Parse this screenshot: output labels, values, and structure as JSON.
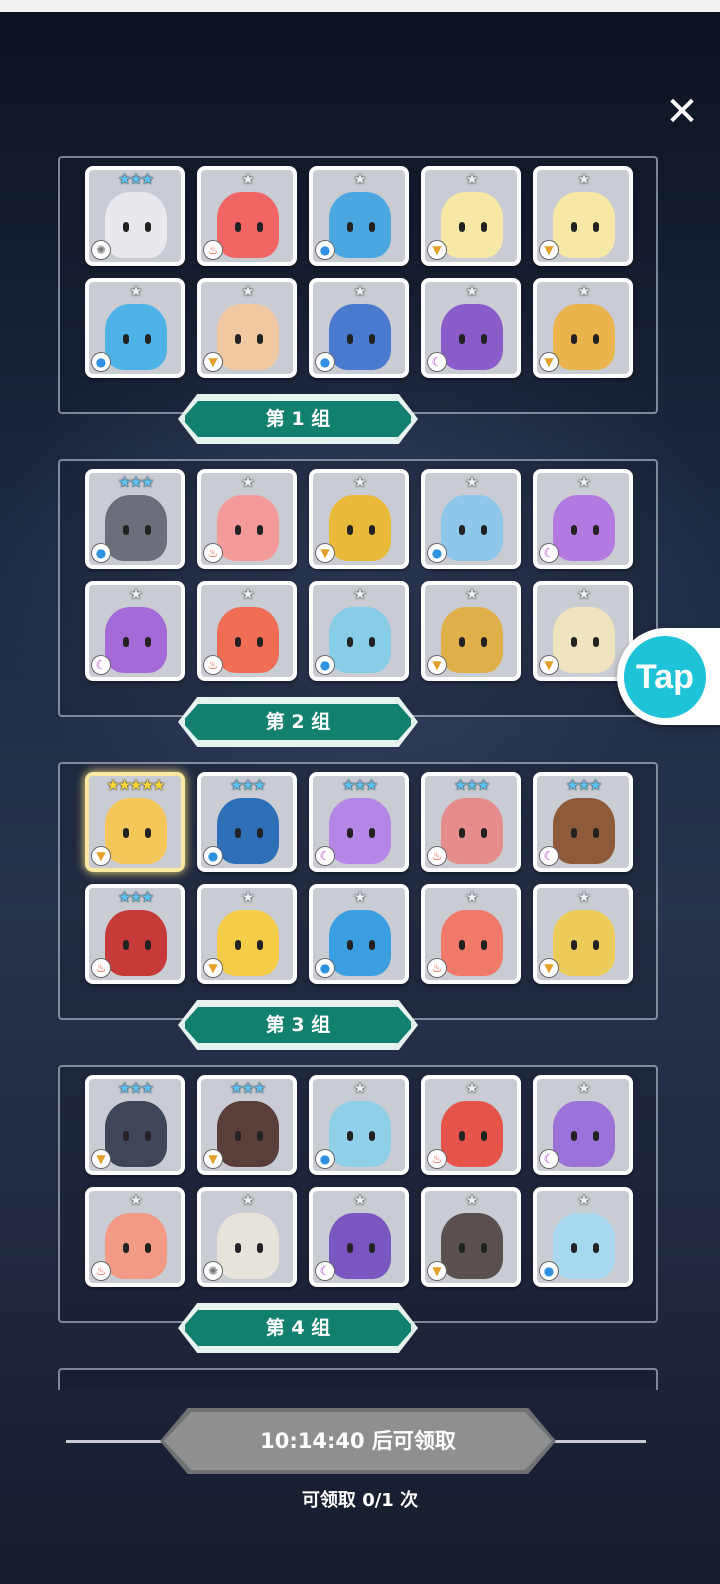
{
  "close_icon": "close-icon",
  "groups": [
    {
      "label": "第 1 组",
      "cards": [
        {
          "stars": "★★★",
          "tier": "three",
          "element": "light",
          "color": "#e8e8ee"
        },
        {
          "stars": "★",
          "tier": "one",
          "element": "fire",
          "color": "#f26565"
        },
        {
          "stars": "★",
          "tier": "one",
          "element": "water",
          "color": "#4aa7e0"
        },
        {
          "stars": "★",
          "tier": "one",
          "element": "wind",
          "color": "#f7e8a8"
        },
        {
          "stars": "★",
          "tier": "one",
          "element": "wind",
          "color": "#f7e8a8"
        },
        {
          "stars": "★",
          "tier": "one",
          "element": "water",
          "color": "#4fb2e6"
        },
        {
          "stars": "★",
          "tier": "one",
          "element": "wind",
          "color": "#f0c8a2"
        },
        {
          "stars": "★",
          "tier": "one",
          "element": "water",
          "color": "#4a7ad0"
        },
        {
          "stars": "★",
          "tier": "one",
          "element": "dark",
          "color": "#8a5cc9"
        },
        {
          "stars": "★",
          "tier": "one",
          "element": "wind",
          "color": "#e9b44c"
        }
      ]
    },
    {
      "label": "第 2 组",
      "cards": [
        {
          "stars": "★★★",
          "tier": "three",
          "element": "water",
          "color": "#6a6f7a"
        },
        {
          "stars": "★",
          "tier": "one",
          "element": "fire",
          "color": "#f49a9a"
        },
        {
          "stars": "★",
          "tier": "one",
          "element": "wind",
          "color": "#e8b93a"
        },
        {
          "stars": "★",
          "tier": "one",
          "element": "water",
          "color": "#8ec7ea"
        },
        {
          "stars": "★",
          "tier": "one",
          "element": "dark",
          "color": "#b27ae0"
        },
        {
          "stars": "★",
          "tier": "one",
          "element": "dark",
          "color": "#a46ad8"
        },
        {
          "stars": "★",
          "tier": "one",
          "element": "fire",
          "color": "#ef6c55"
        },
        {
          "stars": "★",
          "tier": "one",
          "element": "water",
          "color": "#87cde8"
        },
        {
          "stars": "★",
          "tier": "one",
          "element": "wind",
          "color": "#dfb04a"
        },
        {
          "stars": "★",
          "tier": "one",
          "element": "wind",
          "color": "#f0e3c0"
        }
      ]
    },
    {
      "label": "第 3 组",
      "cards": [
        {
          "stars": "★★★★★",
          "tier": "five",
          "element": "wind",
          "color": "#f5c65a",
          "gold": true
        },
        {
          "stars": "★★★",
          "tier": "three",
          "element": "water",
          "color": "#2f6fb8"
        },
        {
          "stars": "★★★",
          "tier": "three",
          "element": "dark",
          "color": "#b487e6"
        },
        {
          "stars": "★★★",
          "tier": "three",
          "element": "fire",
          "color": "#e58c8c"
        },
        {
          "stars": "★★★",
          "tier": "three",
          "element": "dark",
          "color": "#8e5a3a"
        },
        {
          "stars": "★★★",
          "tier": "three",
          "element": "fire",
          "color": "#c63a3a"
        },
        {
          "stars": "★",
          "tier": "one",
          "element": "wind",
          "color": "#f5cd48"
        },
        {
          "stars": "★",
          "tier": "one",
          "element": "water",
          "color": "#3a9ee0"
        },
        {
          "stars": "★",
          "tier": "one",
          "element": "fire",
          "color": "#f07a6a"
        },
        {
          "stars": "★",
          "tier": "one",
          "element": "wind",
          "color": "#eccb5a"
        }
      ]
    },
    {
      "label": "第 4 组",
      "cards": [
        {
          "stars": "★★★",
          "tier": "three",
          "element": "wind",
          "color": "#3f4658"
        },
        {
          "stars": "★★★",
          "tier": "three",
          "element": "wind",
          "color": "#5a3e3a"
        },
        {
          "stars": "★",
          "tier": "one",
          "element": "water",
          "color": "#8fd0e8"
        },
        {
          "stars": "★",
          "tier": "one",
          "element": "fire",
          "color": "#e5544a"
        },
        {
          "stars": "★",
          "tier": "one",
          "element": "dark",
          "color": "#9a72d8"
        },
        {
          "stars": "★",
          "tier": "one",
          "element": "fire",
          "color": "#f29a86"
        },
        {
          "stars": "★",
          "tier": "one",
          "element": "light",
          "color": "#e6e3da"
        },
        {
          "stars": "★",
          "tier": "one",
          "element": "dark",
          "color": "#7a56c0"
        },
        {
          "stars": "★",
          "tier": "one",
          "element": "wind",
          "color": "#5a5050"
        },
        {
          "stars": "★",
          "tier": "one",
          "element": "water",
          "color": "#a8d8ef"
        }
      ]
    }
  ],
  "element_icons": {
    "fire": {
      "glyph": "♨",
      "color": "#e2452c"
    },
    "water": {
      "glyph": "●",
      "color": "#2f8fe0"
    },
    "wind": {
      "glyph": "▼",
      "color": "#e3a02a"
    },
    "dark": {
      "glyph": "☾",
      "color": "#b03acb"
    },
    "light": {
      "glyph": "✺",
      "color": "#7b7b7b"
    }
  },
  "tap_button": {
    "label": "Tap"
  },
  "claim": {
    "timer_text": "10:14:40 后可领取",
    "count_text": "可领取 0/1 次"
  }
}
